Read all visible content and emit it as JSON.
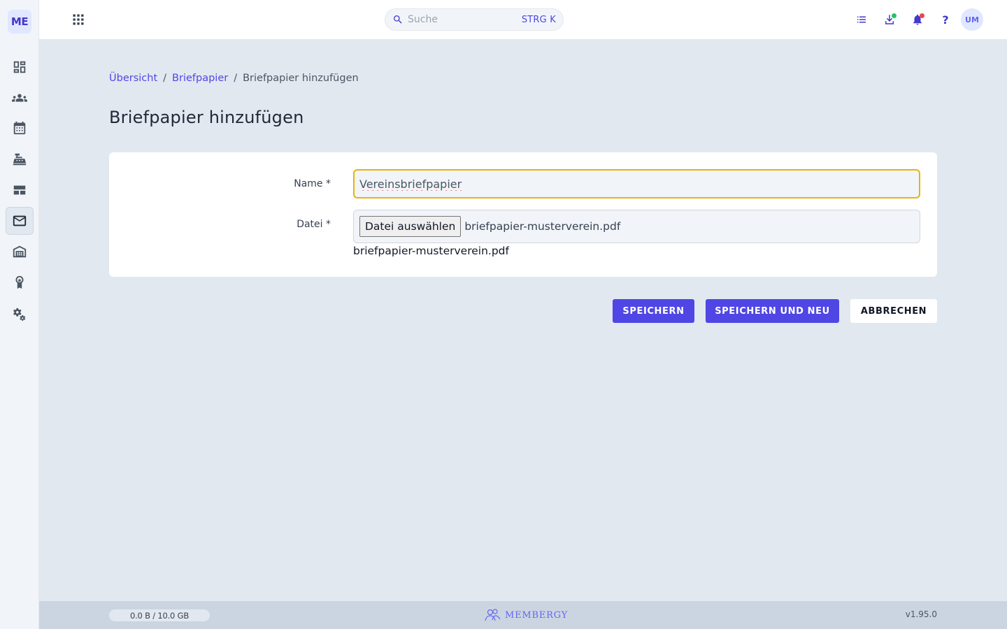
{
  "sidebar": {
    "logo": "ME",
    "items": [
      {
        "icon": "dashboard-icon"
      },
      {
        "icon": "members-icon"
      },
      {
        "icon": "calendar-icon"
      },
      {
        "icon": "cash-register-icon"
      },
      {
        "icon": "layout-icon"
      },
      {
        "icon": "mail-icon",
        "active": true
      },
      {
        "icon": "warehouse-icon"
      },
      {
        "icon": "award-icon"
      },
      {
        "icon": "settings-icon"
      }
    ]
  },
  "topbar": {
    "search_placeholder": "Suche",
    "search_shortcut": "STRG K",
    "avatar_initials": "UM",
    "help_label": "?",
    "colors": {
      "download_dot": "#22c55e",
      "notification_dot": "#ef4444"
    }
  },
  "breadcrumb": {
    "items": [
      "Übersicht",
      "Briefpapier"
    ],
    "separator": "/",
    "current": "Briefpapier hinzufügen"
  },
  "page_title": "Briefpapier hinzufügen",
  "form": {
    "name_label": "Name *",
    "name_value": "Vereinsbriefpapier",
    "file_label": "Datei *",
    "file_button": "Datei auswählen",
    "file_name": "briefpapier-musterverein.pdf",
    "file_name_below": "briefpapier-musterverein.pdf"
  },
  "actions": {
    "save": "SPEICHERN",
    "save_new": "SPEICHERN UND NEU",
    "cancel": "ABBRECHEN"
  },
  "footer": {
    "storage": "0.0 B / 10.0 GB",
    "brand": "MEMBERGY",
    "version": "v1.95.0"
  },
  "colors": {
    "accent": "#4f46e5",
    "focus_border": "#eab308",
    "background": "#e2e8f0"
  }
}
